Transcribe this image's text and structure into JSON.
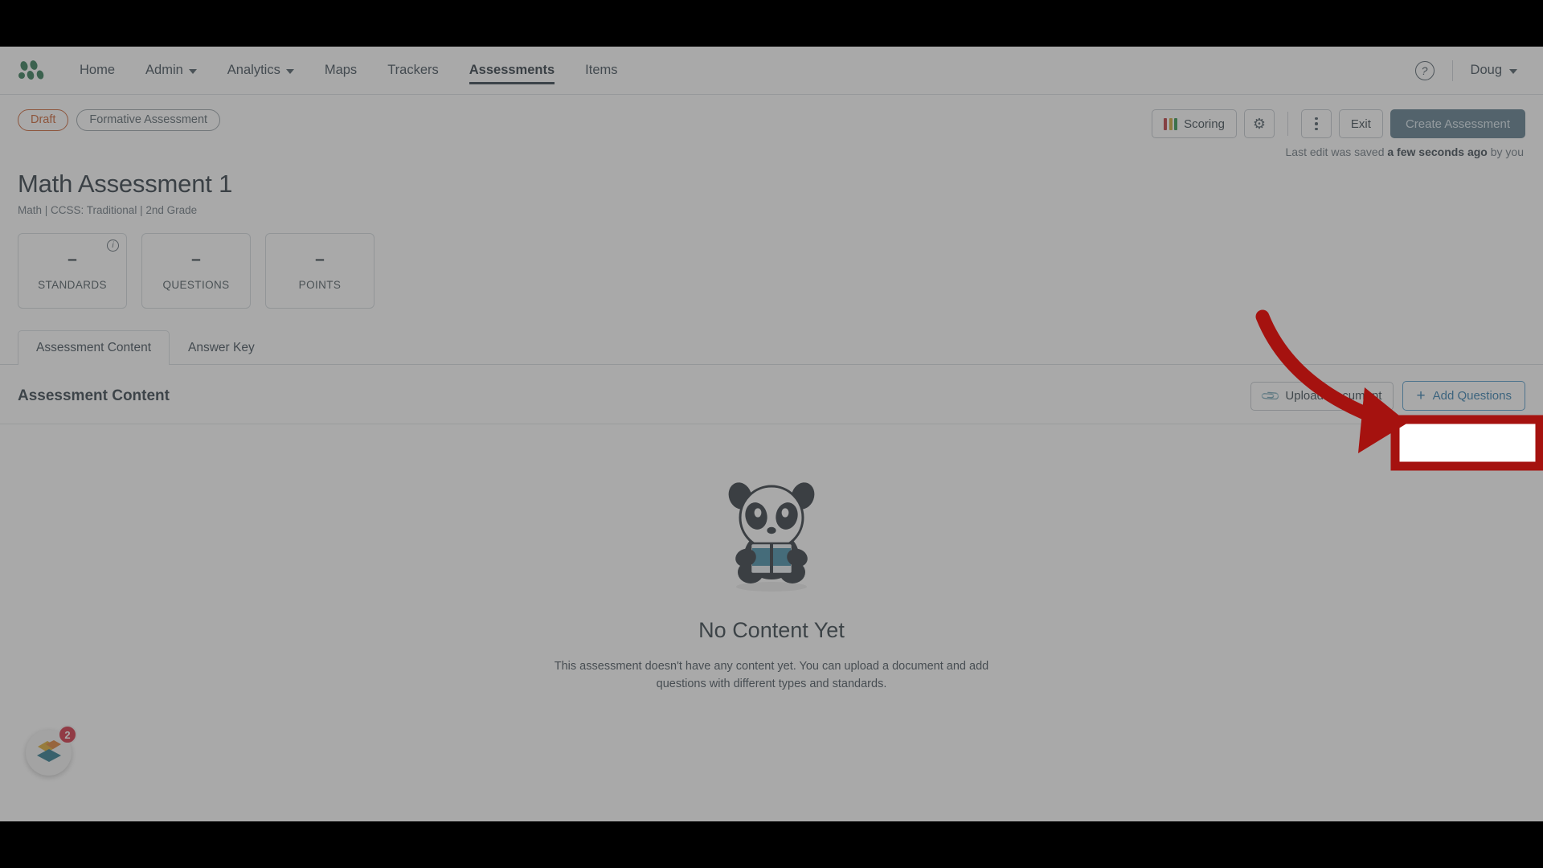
{
  "app": {
    "brand_logo": "three-leaf-dots-logo",
    "brand_color": "#1d6b43"
  },
  "nav": {
    "items": [
      {
        "label": "Home",
        "has_caret": false,
        "active": false
      },
      {
        "label": "Admin",
        "has_caret": true,
        "active": false
      },
      {
        "label": "Analytics",
        "has_caret": true,
        "active": false
      },
      {
        "label": "Maps",
        "has_caret": false,
        "active": false
      },
      {
        "label": "Trackers",
        "has_caret": false,
        "active": false
      },
      {
        "label": "Assessments",
        "has_caret": false,
        "active": true
      },
      {
        "label": "Items",
        "has_caret": false,
        "active": false
      }
    ],
    "help_glyph": "?",
    "user_name": "Doug"
  },
  "toolbar": {
    "status_badge": "Draft",
    "type_badge": "Formative Assessment",
    "scoring_label": "Scoring",
    "scoring_colors": [
      "#b3252b",
      "#c8a020",
      "#1f8a3c"
    ],
    "settings_icon": "gear-icon",
    "more_icon": "kebab-menu-icon",
    "exit_label": "Exit",
    "create_label": "Create Assessment",
    "saved_prefix": "Last edit was saved ",
    "saved_strong": "a few seconds ago",
    "saved_suffix": " by you"
  },
  "header": {
    "title": "Math Assessment 1",
    "subtitle": "Math  |  CCSS: Traditional  |  2nd Grade"
  },
  "stats": [
    {
      "value": "–",
      "label": "STANDARDS",
      "info": "i"
    },
    {
      "value": "–",
      "label": "QUESTIONS",
      "info": ""
    },
    {
      "value": "–",
      "label": "POINTS",
      "info": ""
    }
  ],
  "tabs": [
    {
      "label": "Assessment Content",
      "active": true
    },
    {
      "label": "Answer Key",
      "active": false
    }
  ],
  "section": {
    "title": "Assessment Content",
    "upload_label": "Upload Document",
    "upload_icon": "paperclip-icon",
    "add_questions_label": "Add Questions",
    "add_questions_plus": "+"
  },
  "empty_state": {
    "illustration": "panda-with-book-icon",
    "heading": "No Content Yet",
    "body_line1": "This assessment doesn't have any content yet. You can upload a document and add",
    "body_line2": "questions with different types and standards."
  },
  "fab": {
    "icon": "diamond-stack-icon",
    "badge_count": "2",
    "badge_color": "#cc1b2e"
  },
  "annotation": {
    "highlight_color": "#a5120f",
    "arrow_shape": "curved-arrow-right",
    "target": "add-questions-button"
  }
}
